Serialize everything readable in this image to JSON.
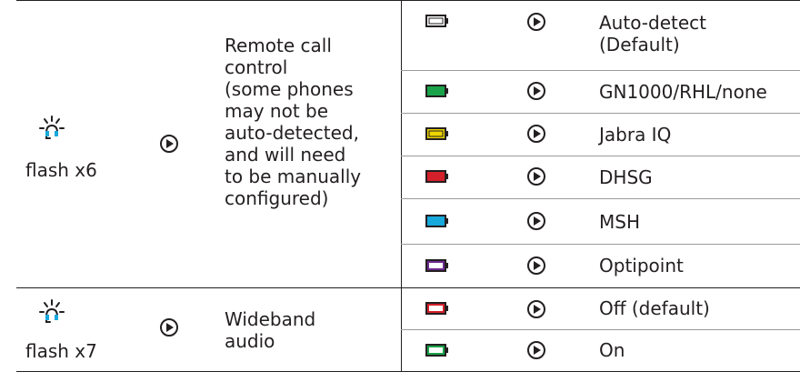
{
  "colors": {
    "line": "#231f20",
    "text": "#231f20",
    "battery_white": "#ffffff",
    "battery_green": "#1aa34a",
    "battery_yellow": "#ecd400",
    "battery_red": "#d3202a",
    "battery_blue": "#17a8dc",
    "battery_purple": "#6d2b8f"
  },
  "rows": [
    {
      "icon": "headset-flash-icon",
      "flash_label": "flash x6",
      "arrow_icon": "play-circle-icon",
      "setting_label": "Remote call control (some phones may not be auto-detected, and will need to be manually configured)",
      "setting_lines": [
        "Remote call",
        "control",
        "(some phones",
        "may not be",
        "auto-detected,",
        "and will need",
        "to be manually",
        "configured)"
      ],
      "options": [
        {
          "battery_color": "white",
          "arrow_icon": "play-circle-icon",
          "label_lines": [
            "Auto-detect",
            "(Default)"
          ]
        },
        {
          "battery_color": "green",
          "arrow_icon": "play-circle-icon",
          "label_lines": [
            "GN1000/RHL/none"
          ]
        },
        {
          "battery_color": "yellow",
          "arrow_icon": "play-circle-icon",
          "label_lines": [
            "Jabra IQ"
          ]
        },
        {
          "battery_color": "red",
          "arrow_icon": "play-circle-icon",
          "label_lines": [
            "DHSG"
          ]
        },
        {
          "battery_color": "blue",
          "arrow_icon": "play-circle-icon",
          "label_lines": [
            "MSH"
          ]
        },
        {
          "battery_color": "purple",
          "arrow_icon": "play-circle-icon",
          "label_lines": [
            "Optipoint"
          ]
        }
      ]
    },
    {
      "icon": "headset-flash-icon",
      "flash_label": "flash x7",
      "arrow_icon": "play-circle-icon",
      "setting_lines": [
        "Wideband",
        "audio"
      ],
      "options": [
        {
          "battery_color": "red",
          "arrow_icon": "play-circle-icon",
          "label_lines": [
            "Off (default)"
          ]
        },
        {
          "battery_color": "green",
          "arrow_icon": "play-circle-icon",
          "label_lines": [
            "On"
          ]
        }
      ]
    }
  ]
}
